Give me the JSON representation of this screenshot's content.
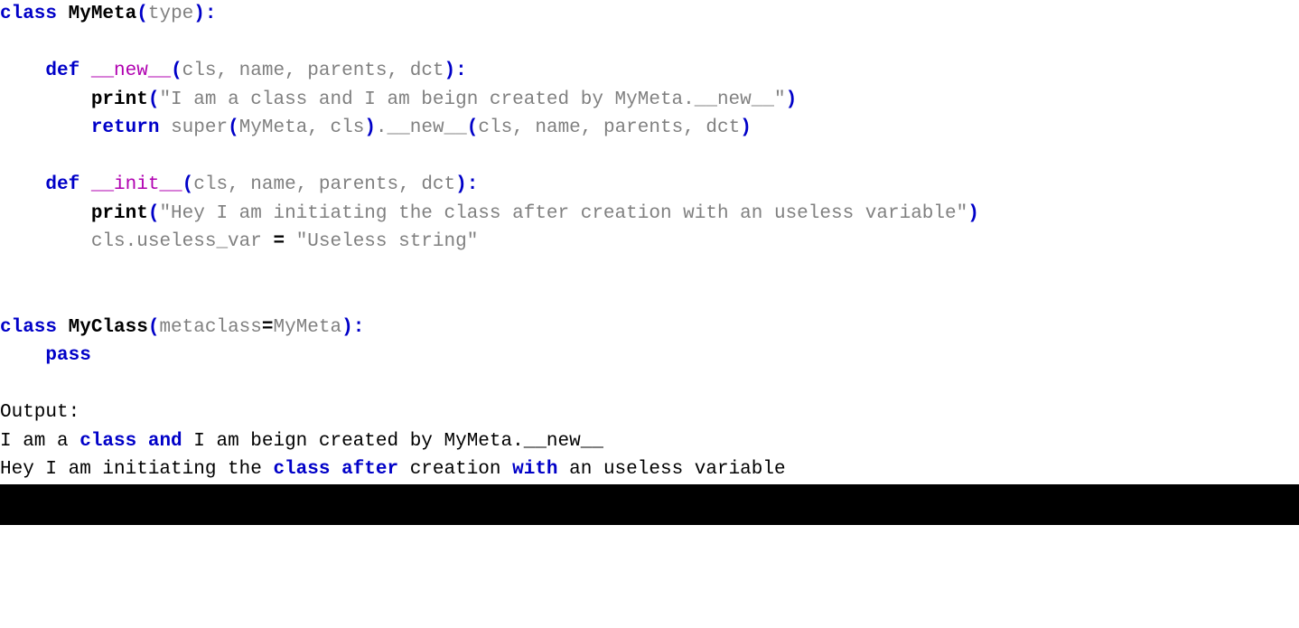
{
  "code": {
    "l1": {
      "kw_class": "class",
      "name": "MyMeta",
      "paren_open": "(",
      "base": "type",
      "paren_close": ")",
      "colon": ":"
    },
    "l3": {
      "kw_def": "def",
      "dunder": "__new__",
      "paren_open": "(",
      "params": "cls, name, parents, dct",
      "paren_close": ")",
      "colon": ":"
    },
    "l4": {
      "builtin": "print",
      "paren_open": "(",
      "string": "\"I am a class and I am beign created by MyMeta.__new__\"",
      "paren_close": ")"
    },
    "l5": {
      "kw_return": "return",
      "super_fn": "super",
      "po1": "(",
      "arg1": "MyMeta, cls",
      "pc1": ")",
      "dot": ".",
      "dunder": "__new__",
      "po2": "(",
      "arg2": "cls, name, parents, dct",
      "pc2": ")"
    },
    "l7": {
      "kw_def": "def",
      "dunder": "__init__",
      "paren_open": "(",
      "params": "cls, name, parents, dct",
      "paren_close": ")",
      "colon": ":"
    },
    "l8": {
      "builtin": "print",
      "paren_open": "(",
      "string": "\"Hey I am initiating the class after creation with an useless variable\"",
      "paren_close": ")"
    },
    "l9": {
      "lhs": "cls.useless_var",
      "op": "=",
      "rhs": "\"Useless string\""
    },
    "l12": {
      "kw_class": "class",
      "name": "MyClass",
      "paren_open": "(",
      "meta_key": "metaclass",
      "op": "=",
      "meta_val": "MyMeta",
      "paren_close": ")",
      "colon": ":"
    },
    "l13": {
      "kw_pass": "pass"
    }
  },
  "output": {
    "label": "Output:",
    "line1": {
      "p1": "I am a ",
      "kw1": "class",
      "sp1": " ",
      "kw2": "and",
      "p2": " I am beign created by MyMeta.__new__"
    },
    "line2": {
      "p1": "Hey I am initiating the ",
      "kw1": "class",
      "sp1": " ",
      "kw2": "after",
      "p2": " creation ",
      "kw3": "with",
      "p3": " an useless variable"
    }
  }
}
